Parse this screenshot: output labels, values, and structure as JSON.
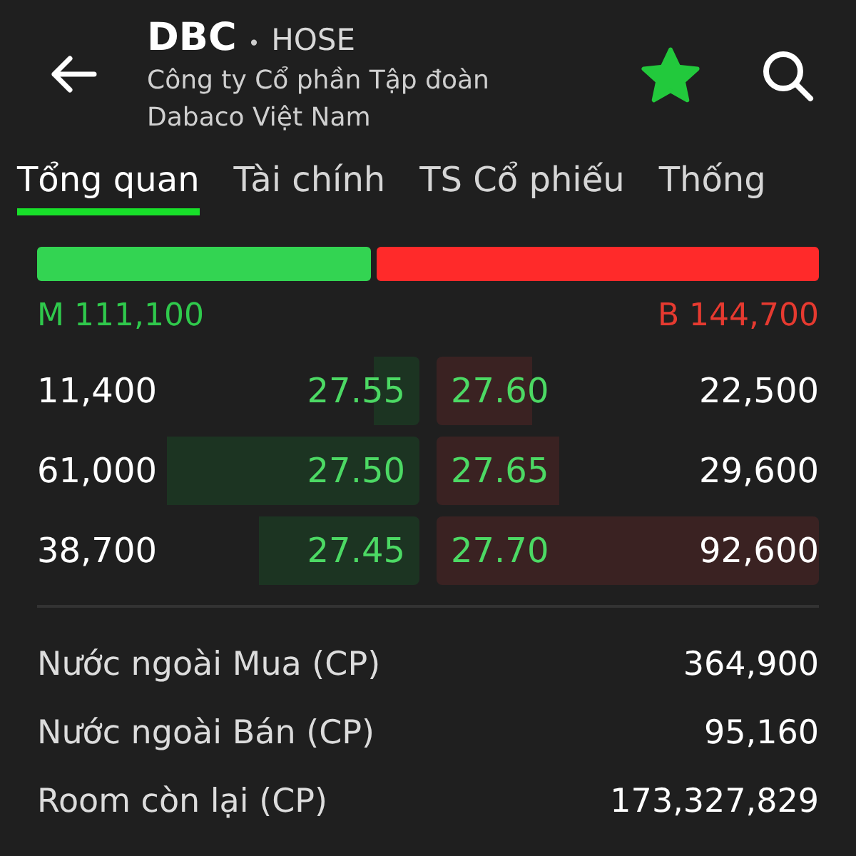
{
  "header": {
    "symbol": "DBC",
    "separator": "•",
    "exchange": "HOSE",
    "company": "Công ty Cổ phần Tập đoàn Dabaco Việt Nam",
    "favorite": true
  },
  "tabs": [
    {
      "label": "Tổng quan",
      "selected": true
    },
    {
      "label": "Tài chính",
      "selected": false
    },
    {
      "label": "TS Cổ phiếu",
      "selected": false
    },
    {
      "label": "Thống",
      "selected": false
    }
  ],
  "order_balance": {
    "buy_total": "M 111,100",
    "sell_total": "B 144,700"
  },
  "order_book": [
    {
      "bid_volume": "11,400",
      "bid_price": "27.55",
      "ask_price": "27.60",
      "ask_volume": "22,500"
    },
    {
      "bid_volume": "61,000",
      "bid_price": "27.50",
      "ask_price": "27.65",
      "ask_volume": "29,600"
    },
    {
      "bid_volume": "38,700",
      "bid_price": "27.45",
      "ask_price": "27.70",
      "ask_volume": "92,600"
    }
  ],
  "stats": [
    {
      "label": "Nước ngoài Mua (CP)",
      "value": "364,900"
    },
    {
      "label": "Nước ngoài Bán (CP)",
      "value": "95,160"
    },
    {
      "label": "Room còn lại (CP)",
      "value": "173,327,829"
    }
  ]
}
